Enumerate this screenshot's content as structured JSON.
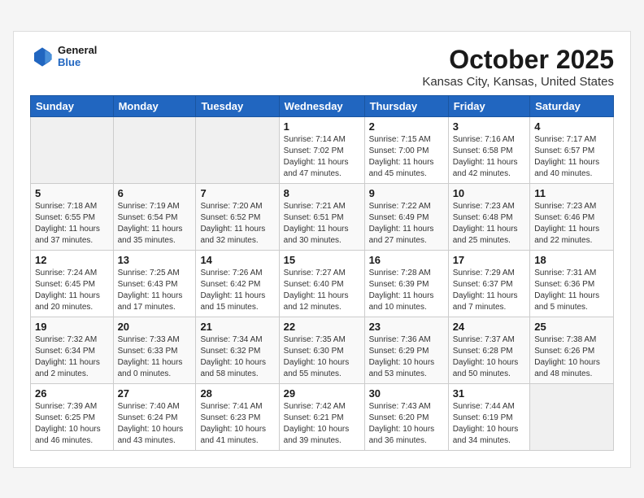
{
  "header": {
    "logo_general": "General",
    "logo_blue": "Blue",
    "month": "October 2025",
    "location": "Kansas City, Kansas, United States"
  },
  "weekdays": [
    "Sunday",
    "Monday",
    "Tuesday",
    "Wednesday",
    "Thursday",
    "Friday",
    "Saturday"
  ],
  "weeks": [
    [
      {
        "day": "",
        "info": ""
      },
      {
        "day": "",
        "info": ""
      },
      {
        "day": "",
        "info": ""
      },
      {
        "day": "1",
        "info": "Sunrise: 7:14 AM\nSunset: 7:02 PM\nDaylight: 11 hours\nand 47 minutes."
      },
      {
        "day": "2",
        "info": "Sunrise: 7:15 AM\nSunset: 7:00 PM\nDaylight: 11 hours\nand 45 minutes."
      },
      {
        "day": "3",
        "info": "Sunrise: 7:16 AM\nSunset: 6:58 PM\nDaylight: 11 hours\nand 42 minutes."
      },
      {
        "day": "4",
        "info": "Sunrise: 7:17 AM\nSunset: 6:57 PM\nDaylight: 11 hours\nand 40 minutes."
      }
    ],
    [
      {
        "day": "5",
        "info": "Sunrise: 7:18 AM\nSunset: 6:55 PM\nDaylight: 11 hours\nand 37 minutes."
      },
      {
        "day": "6",
        "info": "Sunrise: 7:19 AM\nSunset: 6:54 PM\nDaylight: 11 hours\nand 35 minutes."
      },
      {
        "day": "7",
        "info": "Sunrise: 7:20 AM\nSunset: 6:52 PM\nDaylight: 11 hours\nand 32 minutes."
      },
      {
        "day": "8",
        "info": "Sunrise: 7:21 AM\nSunset: 6:51 PM\nDaylight: 11 hours\nand 30 minutes."
      },
      {
        "day": "9",
        "info": "Sunrise: 7:22 AM\nSunset: 6:49 PM\nDaylight: 11 hours\nand 27 minutes."
      },
      {
        "day": "10",
        "info": "Sunrise: 7:23 AM\nSunset: 6:48 PM\nDaylight: 11 hours\nand 25 minutes."
      },
      {
        "day": "11",
        "info": "Sunrise: 7:23 AM\nSunset: 6:46 PM\nDaylight: 11 hours\nand 22 minutes."
      }
    ],
    [
      {
        "day": "12",
        "info": "Sunrise: 7:24 AM\nSunset: 6:45 PM\nDaylight: 11 hours\nand 20 minutes."
      },
      {
        "day": "13",
        "info": "Sunrise: 7:25 AM\nSunset: 6:43 PM\nDaylight: 11 hours\nand 17 minutes."
      },
      {
        "day": "14",
        "info": "Sunrise: 7:26 AM\nSunset: 6:42 PM\nDaylight: 11 hours\nand 15 minutes."
      },
      {
        "day": "15",
        "info": "Sunrise: 7:27 AM\nSunset: 6:40 PM\nDaylight: 11 hours\nand 12 minutes."
      },
      {
        "day": "16",
        "info": "Sunrise: 7:28 AM\nSunset: 6:39 PM\nDaylight: 11 hours\nand 10 minutes."
      },
      {
        "day": "17",
        "info": "Sunrise: 7:29 AM\nSunset: 6:37 PM\nDaylight: 11 hours\nand 7 minutes."
      },
      {
        "day": "18",
        "info": "Sunrise: 7:31 AM\nSunset: 6:36 PM\nDaylight: 11 hours\nand 5 minutes."
      }
    ],
    [
      {
        "day": "19",
        "info": "Sunrise: 7:32 AM\nSunset: 6:34 PM\nDaylight: 11 hours\nand 2 minutes."
      },
      {
        "day": "20",
        "info": "Sunrise: 7:33 AM\nSunset: 6:33 PM\nDaylight: 11 hours\nand 0 minutes."
      },
      {
        "day": "21",
        "info": "Sunrise: 7:34 AM\nSunset: 6:32 PM\nDaylight: 10 hours\nand 58 minutes."
      },
      {
        "day": "22",
        "info": "Sunrise: 7:35 AM\nSunset: 6:30 PM\nDaylight: 10 hours\nand 55 minutes."
      },
      {
        "day": "23",
        "info": "Sunrise: 7:36 AM\nSunset: 6:29 PM\nDaylight: 10 hours\nand 53 minutes."
      },
      {
        "day": "24",
        "info": "Sunrise: 7:37 AM\nSunset: 6:28 PM\nDaylight: 10 hours\nand 50 minutes."
      },
      {
        "day": "25",
        "info": "Sunrise: 7:38 AM\nSunset: 6:26 PM\nDaylight: 10 hours\nand 48 minutes."
      }
    ],
    [
      {
        "day": "26",
        "info": "Sunrise: 7:39 AM\nSunset: 6:25 PM\nDaylight: 10 hours\nand 46 minutes."
      },
      {
        "day": "27",
        "info": "Sunrise: 7:40 AM\nSunset: 6:24 PM\nDaylight: 10 hours\nand 43 minutes."
      },
      {
        "day": "28",
        "info": "Sunrise: 7:41 AM\nSunset: 6:23 PM\nDaylight: 10 hours\nand 41 minutes."
      },
      {
        "day": "29",
        "info": "Sunrise: 7:42 AM\nSunset: 6:21 PM\nDaylight: 10 hours\nand 39 minutes."
      },
      {
        "day": "30",
        "info": "Sunrise: 7:43 AM\nSunset: 6:20 PM\nDaylight: 10 hours\nand 36 minutes."
      },
      {
        "day": "31",
        "info": "Sunrise: 7:44 AM\nSunset: 6:19 PM\nDaylight: 10 hours\nand 34 minutes."
      },
      {
        "day": "",
        "info": ""
      }
    ]
  ]
}
